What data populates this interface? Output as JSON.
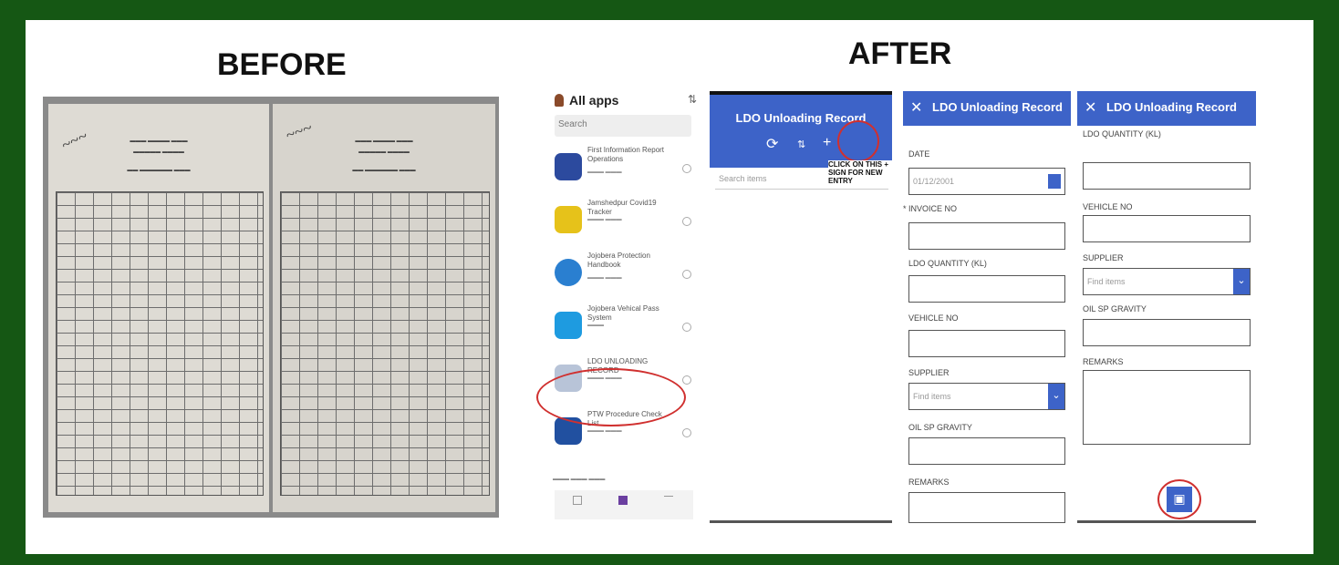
{
  "headings": {
    "before": "BEFORE",
    "after": "AFTER"
  },
  "colors": {
    "border": "#155714",
    "accent": "#3d63c8",
    "highlight": "#d0302f"
  },
  "before_photo": {
    "description_type": "handwritten logbook photo"
  },
  "app_list": {
    "title": "All apps",
    "search_placeholder": "Search",
    "apps": [
      {
        "name": "First Information Report Operations",
        "icon": "list-icon"
      },
      {
        "name": "Jamshedpur Covid19 Tracker",
        "icon": "tracker-icon"
      },
      {
        "name": "Jojobera Protection Handbook",
        "icon": "warning-icon"
      },
      {
        "name": "Jojobera Vehical Pass System",
        "icon": "pass-icon"
      },
      {
        "name": "LDO UNLOADING RECORD",
        "icon": "truck-icon"
      },
      {
        "name": "PTW Procedure Check List",
        "icon": "checklist-icon"
      }
    ]
  },
  "screen1": {
    "title": "LDO Unloading Record",
    "search_placeholder": "Search items",
    "note": "CLICK ON THIS + SIGN FOR NEW ENTRY"
  },
  "screen2": {
    "title": "LDO Unloading Record",
    "fields": {
      "date_label": "DATE",
      "date_value": "01/12/2001",
      "invoice_label": "* INVOICE NO",
      "qty_label": "LDO QUANTITY (KL)",
      "vehicle_label": "VEHICLE NO",
      "supplier_label": "SUPPLIER",
      "supplier_placeholder": "Find items",
      "gravity_label": "OIL SP GRAVITY",
      "remarks_label": "REMARKS"
    }
  },
  "screen3": {
    "title": "LDO Unloading Record",
    "fields": {
      "qty_label": "LDO QUANTITY (KL)",
      "vehicle_label": "VEHICLE NO",
      "supplier_label": "SUPPLIER",
      "supplier_placeholder": "Find items",
      "gravity_label": "OIL SP GRAVITY",
      "remarks_label": "REMARKS"
    }
  }
}
